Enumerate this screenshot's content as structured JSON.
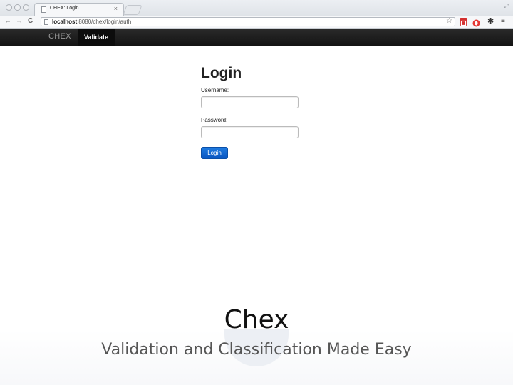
{
  "browser": {
    "tab_title": "CHEX: Login",
    "tab_close": "×",
    "url_host": "localhost",
    "url_path": ":8080/chex/login/auth",
    "icons": [
      "back-icon",
      "forward-icon",
      "reload-icon",
      "bookmark-star-icon",
      "extension-red-icon",
      "extension-opera-icon",
      "settings-gear-icon",
      "menu-icon"
    ],
    "colors": {
      "extension_red": "#d32f2f",
      "extension_opera": "#e53935"
    }
  },
  "navbar": {
    "brand": "CHEX",
    "items": [
      {
        "label": "Validate"
      }
    ]
  },
  "login": {
    "title": "Login",
    "username_label": "Username:",
    "username_value": "",
    "password_label": "Password:",
    "password_value": "",
    "submit_label": "Login",
    "accent": "#0a56c2"
  },
  "slide": {
    "title": "Chex",
    "subtitle": "Validation and Classification Made Easy"
  }
}
